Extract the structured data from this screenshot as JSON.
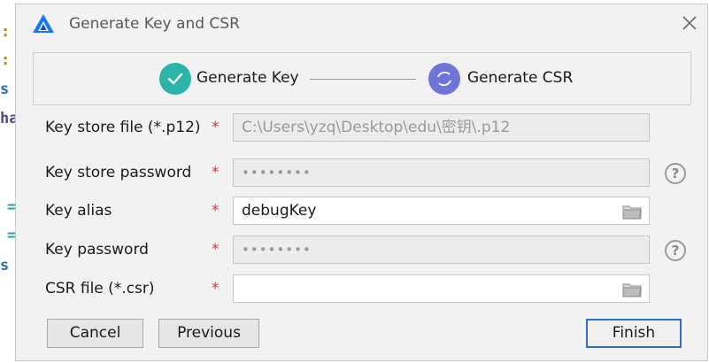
{
  "background_editor": {
    "tokens": [
      {
        "text": ":",
        "color": "#b58900"
      },
      {
        "text": ":",
        "color": "#b58900"
      },
      {
        "text": "s",
        "color": "#2b6cb0"
      },
      {
        "text": "ha",
        "color": "#4a4a8a"
      },
      {
        "text": "=",
        "color": "#2aa198"
      },
      {
        "text": "=",
        "color": "#2aa198"
      },
      {
        "text": "s",
        "color": "#2b6cb0"
      }
    ]
  },
  "dialog": {
    "title": "Generate Key and CSR",
    "icons": {
      "app": "app-logo-icon",
      "close": "close-icon"
    }
  },
  "steps": [
    {
      "label": "Generate Key",
      "state": "done",
      "color": "#2ab3a6",
      "icon": "check-icon"
    },
    {
      "label": "Generate CSR",
      "state": "current",
      "color": "#6e74d8",
      "icon": "refresh-icon"
    }
  ],
  "form": {
    "required_mark": "*",
    "fields": {
      "keystore_file": {
        "label": "Key store file (*.p12)",
        "value": "C:\\Users\\yzq\\Desktop\\edu\\密钥\\.p12"
      },
      "keystore_password": {
        "label": "Key store password",
        "value": "••••••••"
      },
      "key_alias": {
        "label": "Key alias",
        "value": "debugKey"
      },
      "key_password": {
        "label": "Key password",
        "value": "••••••••"
      },
      "csr_file": {
        "label": "CSR file (*.csr)",
        "value": ""
      }
    },
    "help_mark": "?"
  },
  "buttons": {
    "cancel": "Cancel",
    "previous": "Previous",
    "finish": "Finish"
  },
  "colors": {
    "accent": "#2f70c4",
    "required": "#e0322f",
    "step_done": "#2ab3a6",
    "step_current": "#6e74d8"
  }
}
